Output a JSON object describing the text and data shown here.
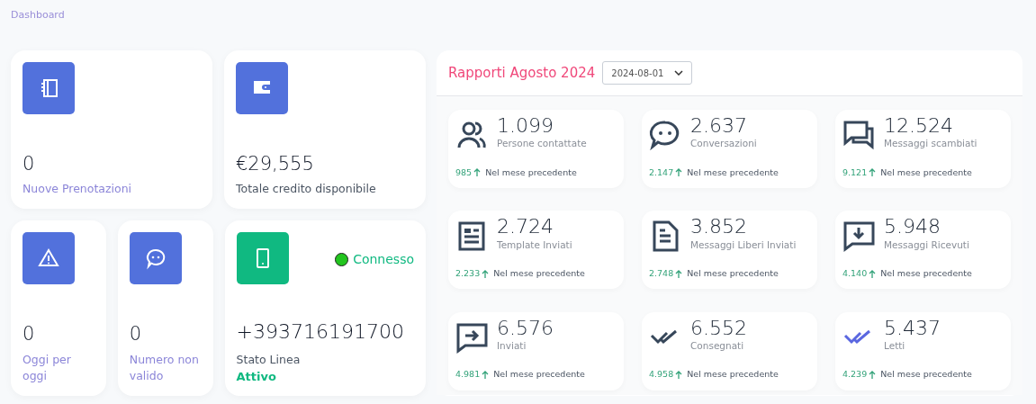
{
  "breadcrumb": "Dashboard",
  "tiles": [
    {
      "kind": "notebook",
      "color": "#5271dc",
      "value": "0",
      "label": "Nuove Prenotazioni",
      "accent": true
    },
    {
      "kind": "wallet",
      "color": "#5271dc",
      "value": "€29,555",
      "label": "Totale credito disponibile",
      "accent": false
    },
    {
      "kind": "warning",
      "color": "#5271dc",
      "value": "0",
      "label": "Oggi per oggi",
      "accent": true
    },
    {
      "kind": "chat",
      "color": "#5271dc",
      "value": "0",
      "label": "Numero non valido",
      "accent": true
    },
    {
      "kind": "phone",
      "color": "#10b981",
      "value": "+393716191700",
      "label": "Stato Linea",
      "status": "Attivo",
      "connection": {
        "label": "Connesso",
        "connected": true
      },
      "accent": false
    }
  ],
  "report": {
    "title": "Rapporti Agosto 2024",
    "date": "2024-08-01",
    "stats": [
      {
        "kind": "users",
        "value": "1.099",
        "label": "Persone contattate",
        "previous": "985",
        "note": "Nel mese precedente"
      },
      {
        "kind": "chat",
        "value": "2.637",
        "label": "Conversazioni",
        "previous": "2.147",
        "note": "Nel mese precedente"
      },
      {
        "kind": "chats",
        "value": "12.524",
        "label": "Messaggi scambiati",
        "previous": "9.121",
        "note": "Nel mese precedente"
      },
      {
        "kind": "article",
        "value": "2.724",
        "label": "Template Inviati",
        "previous": "2.233",
        "note": "Nel mese precedente"
      },
      {
        "kind": "document",
        "value": "3.852",
        "label": "Messaggi Liberi Inviati",
        "previous": "2.748",
        "note": "Nel mese precedente"
      },
      {
        "kind": "inbox",
        "value": "5.948",
        "label": "Messaggi Ricevuti",
        "previous": "4.140",
        "note": "Nel mese precedente"
      },
      {
        "kind": "outbox",
        "value": "6.576",
        "label": "Inviati",
        "previous": "4.981",
        "note": "Nel mese precedente"
      },
      {
        "kind": "delivered",
        "value": "6.552",
        "label": "Consegnati",
        "previous": "4.958",
        "note": "Nel mese precedente"
      },
      {
        "kind": "read",
        "value": "5.437",
        "label": "Letti",
        "previous": "4.239",
        "note": "Nel mese precedente"
      }
    ]
  }
}
